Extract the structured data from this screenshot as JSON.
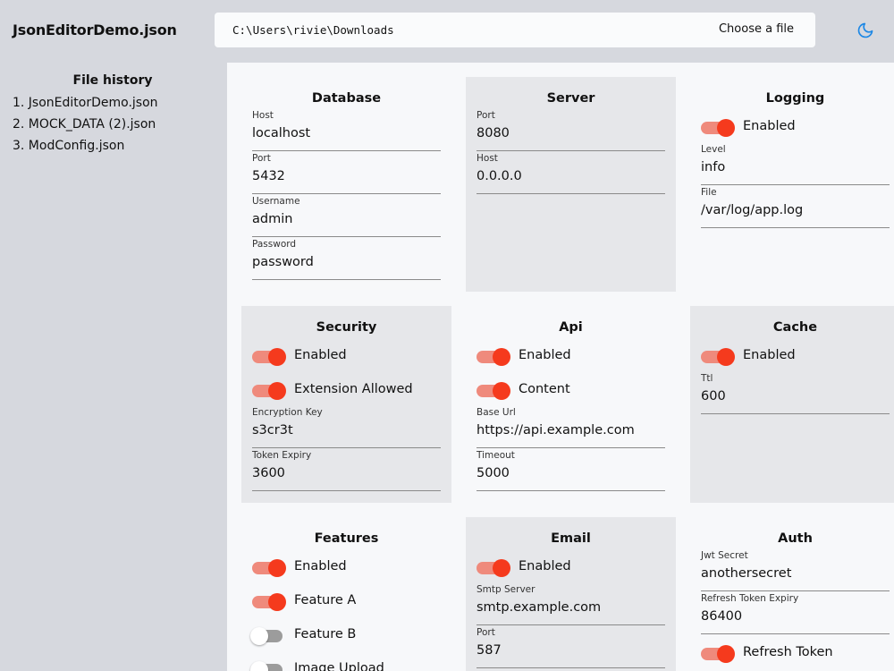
{
  "header": {
    "app_title": "JsonEditorDemo.json",
    "path": "C:\\Users\\rivie\\Downloads",
    "choose_file_label": "Choose a file",
    "theme_icon": "moon-icon",
    "accent_color": "#1e88e5"
  },
  "history": {
    "title": "File history",
    "items": [
      "1. JsonEditorDemo.json",
      "2. MOCK_DATA (2).json",
      "3. ModConfig.json"
    ]
  },
  "colors": {
    "toggle_on": "#f53a1d",
    "toggle_on_track": "#ef8a7c",
    "toggle_off_track": "#9c9c9c"
  },
  "cards": {
    "database": {
      "title": "Database",
      "host_label": "Host",
      "host": "localhost",
      "port_label": "Port",
      "port": "5432",
      "username_label": "Username",
      "username": "admin",
      "password_label": "Password",
      "password": "password"
    },
    "server": {
      "title": "Server",
      "port_label": "Port",
      "port": "8080",
      "host_label": "Host",
      "host": "0.0.0.0"
    },
    "logging": {
      "title": "Logging",
      "enabled_label": "Enabled",
      "enabled": true,
      "level_label": "Level",
      "level": "info",
      "file_label": "File",
      "file": "/var/log/app.log"
    },
    "security": {
      "title": "Security",
      "enabled_label": "Enabled",
      "enabled": true,
      "extension_label": "Extension Allowed",
      "extension_allowed": true,
      "key_label": "Encryption Key",
      "key": "s3cr3t",
      "expiry_label": "Token Expiry",
      "expiry": "3600"
    },
    "api": {
      "title": "Api",
      "enabled_label": "Enabled",
      "enabled": true,
      "content_label": "Content",
      "content": true,
      "base_url_label": "Base Url",
      "base_url": "https://api.example.com",
      "timeout_label": "Timeout",
      "timeout": "5000"
    },
    "cache": {
      "title": "Cache",
      "enabled_label": "Enabled",
      "enabled": true,
      "ttl_label": "Ttl",
      "ttl": "600"
    },
    "features": {
      "title": "Features",
      "enabled_label": "Enabled",
      "enabled": true,
      "feature_a_label": "Feature A",
      "feature_a": true,
      "feature_b_label": "Feature B",
      "feature_b": false,
      "image_upload_label": "Image Upload",
      "image_upload": false
    },
    "email": {
      "title": "Email",
      "enabled_label": "Enabled",
      "enabled": true,
      "smtp_label": "Smtp Server",
      "smtp": "smtp.example.com",
      "port_label": "Port",
      "port": "587"
    },
    "auth": {
      "title": "Auth",
      "jwt_label": "Jwt Secret",
      "jwt": "anothersecret",
      "refresh_expiry_label": "Refresh Token Expiry",
      "refresh_expiry": "86400",
      "refresh_token_label": "Refresh Token",
      "refresh_token": true
    }
  }
}
